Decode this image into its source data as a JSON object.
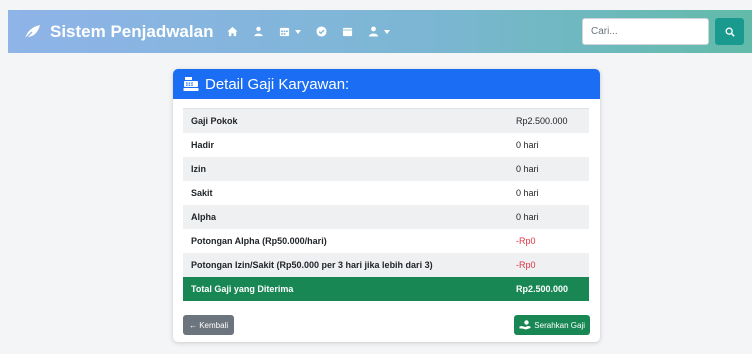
{
  "navbar": {
    "brand": "Sistem Penjadwalan",
    "icons": [
      "home-icon",
      "users-icon",
      "calendar-dropdown-icon",
      "check-circle-icon",
      "calendar-icon",
      "user-dropdown-icon"
    ],
    "search_placeholder": "Cari..."
  },
  "card": {
    "title": "Detail Gaji Karyawan:",
    "rows": [
      {
        "label": "Gaji Pokok",
        "value": "Rp2.500.000"
      },
      {
        "label": "Hadir",
        "value": "0 hari"
      },
      {
        "label": "Izin",
        "value": "0 hari"
      },
      {
        "label": "Sakit",
        "value": "0 hari"
      },
      {
        "label": "Alpha",
        "value": "0 hari"
      },
      {
        "label": "Potongan Alpha (Rp50.000/hari)",
        "value": "-Rp0"
      },
      {
        "label": "Potongan Izin/Sakit (Rp50.000 per 3 hari jika lebih dari 3)",
        "value": "-Rp0"
      }
    ],
    "total": {
      "label": "Total Gaji yang Diterima",
      "value": "Rp2.500.000"
    },
    "back_button": "← Kembali",
    "give_button": "Serahkan Gaji"
  },
  "colors": {
    "header_blue": "#1b6ef3",
    "success_green": "#198754",
    "danger_red": "#dc3545",
    "secondary_gray": "#6c757d"
  }
}
